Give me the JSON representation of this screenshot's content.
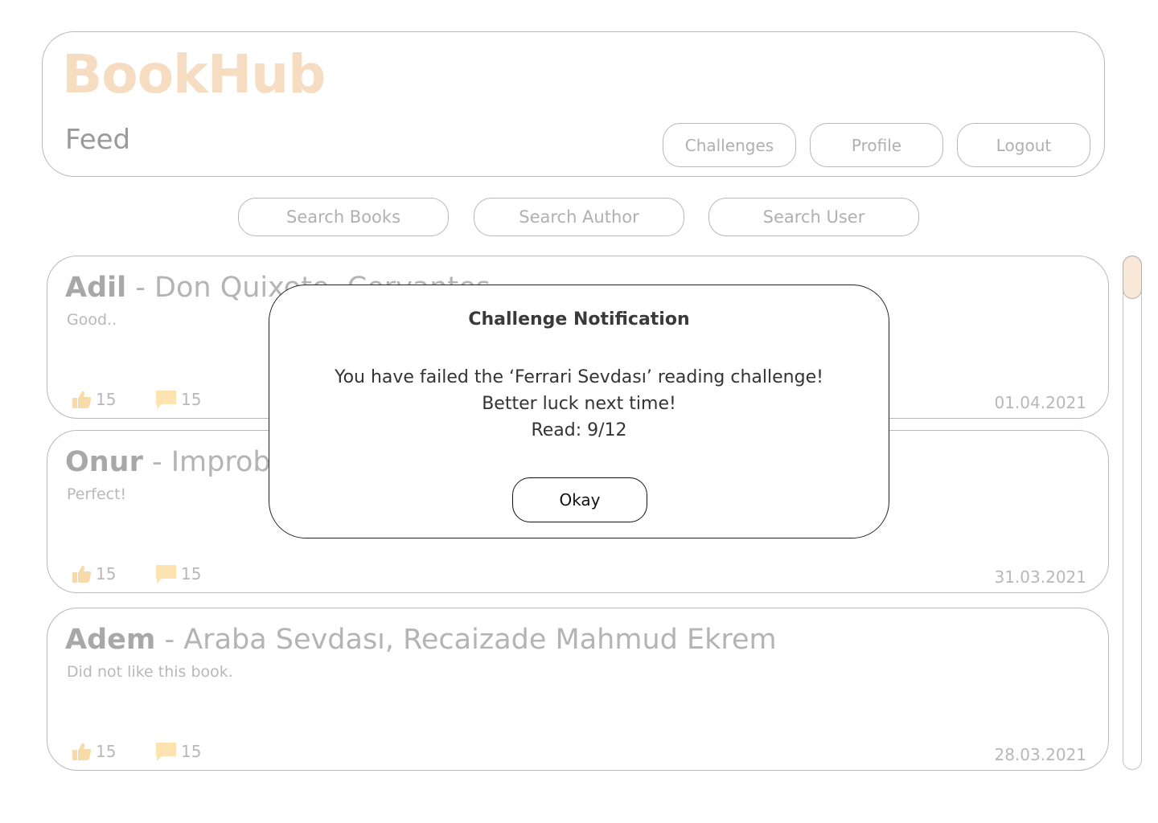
{
  "app": {
    "logo": "BookHub",
    "page_title": "Feed"
  },
  "nav": {
    "challenges": "Challenges",
    "profile": "Profile",
    "logout": "Logout"
  },
  "search": {
    "books": "Search Books",
    "author": "Search Author",
    "user": "Search User"
  },
  "feed": [
    {
      "user": "Adil",
      "book": " - Don Quixote, Cervantes",
      "review": "Good..",
      "likes": "15",
      "comments": "15",
      "date": "01.04.2021"
    },
    {
      "user": "Onur",
      "book": " - Improbable",
      "review": "Perfect!",
      "likes": "15",
      "comments": "15",
      "date": "31.03.2021"
    },
    {
      "user": "Adem",
      "book": " - Araba Sevdası, Recaizade Mahmud Ekrem",
      "review": "Did not like this book.",
      "likes": "15",
      "comments": "15",
      "date": "28.03.2021"
    }
  ],
  "modal": {
    "title": "Challenge Notification",
    "line1": "You have failed the ‘Ferrari Sevdası’ reading challenge!",
    "line2": "Better luck next time!",
    "line3": "Read: 9/12",
    "okay": "Okay"
  },
  "colors": {
    "logo": "#f6dcc1",
    "icon_like": "#f8d9a8",
    "icon_comment": "#fde3b0",
    "scroll_thumb": "#f9e8d8"
  },
  "icons": {
    "like": "thumbs-up-icon",
    "comment": "comment-icon"
  }
}
